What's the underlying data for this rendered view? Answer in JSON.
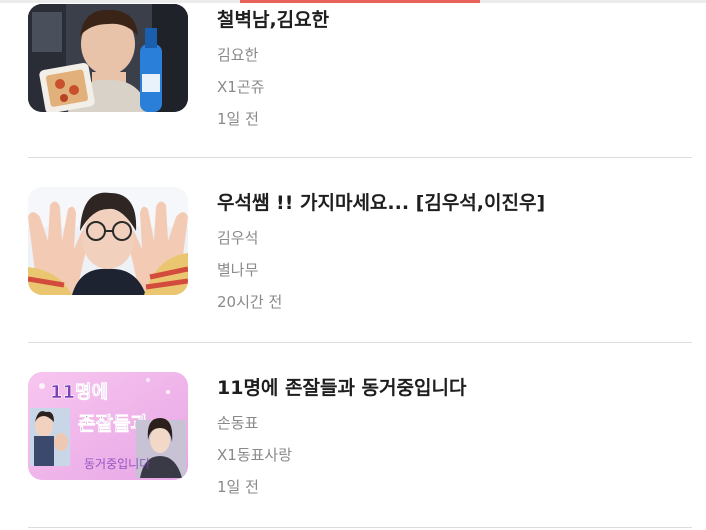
{
  "feed": {
    "items": [
      {
        "title": "철벽남,김요한",
        "character": "김요한",
        "author": "X1곤쥬",
        "time": "1일 전"
      },
      {
        "title": "우석쌤 !! 가지마세요...  [김우석,이진우]",
        "character": "김우석",
        "author": "별나무",
        "time": "20시간 전"
      },
      {
        "title": "11명에 존잘들과 동거중입니다",
        "character": "손동표",
        "author": "X1동표사랑",
        "time": "1일 전",
        "thumbnail_text_top": "11명에",
        "thumbnail_text_mid": "존잘들과",
        "thumbnail_text_bottom": "동거중입니다"
      }
    ]
  },
  "colors": {
    "accent": "#e8625b",
    "title": "#1e1e1e",
    "meta": "#8a8a8a",
    "divider": "#dcdcdc"
  }
}
